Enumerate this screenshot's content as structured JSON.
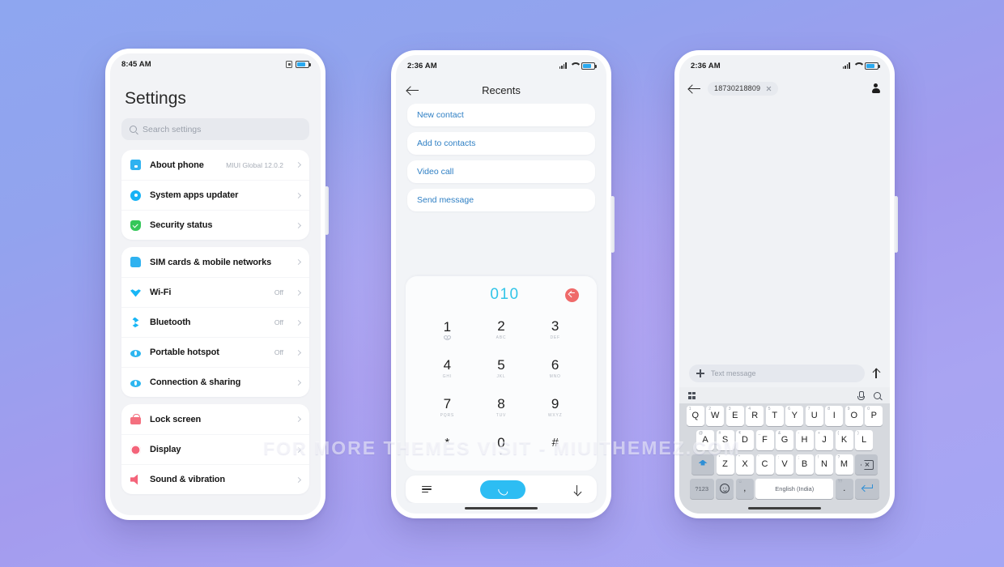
{
  "background": {
    "accent_blue": "#2dbdf3",
    "accent_cyan": "#33c5e8",
    "accent_red": "#ef6a6a",
    "link_blue": "#2e7fc4"
  },
  "watermark": {
    "text": "FOR MORE THEMES VISIT - MIUITHEMEZ.COM"
  },
  "phone1": {
    "status": {
      "time": "8:45 AM"
    },
    "title": "Settings",
    "search": {
      "placeholder": "Search settings"
    },
    "groups": [
      {
        "rows": [
          {
            "icon": "phone-info-icon",
            "label": "About phone",
            "value": "MIUI Global 12.0.2"
          },
          {
            "icon": "system-updater-icon",
            "label": "System apps updater",
            "value": ""
          },
          {
            "icon": "security-shield-icon",
            "label": "Security status",
            "value": ""
          }
        ]
      },
      {
        "rows": [
          {
            "icon": "sim-card-icon",
            "label": "SIM cards & mobile networks",
            "value": ""
          },
          {
            "icon": "wifi-icon",
            "label": "Wi-Fi",
            "value": "Off"
          },
          {
            "icon": "bluetooth-icon",
            "label": "Bluetooth",
            "value": "Off"
          },
          {
            "icon": "hotspot-icon",
            "label": "Portable hotspot",
            "value": "Off"
          },
          {
            "icon": "connection-sharing-icon",
            "label": "Connection & sharing",
            "value": ""
          }
        ]
      },
      {
        "rows": [
          {
            "icon": "lock-icon",
            "label": "Lock screen",
            "value": ""
          },
          {
            "icon": "display-icon",
            "label": "Display",
            "value": ""
          },
          {
            "icon": "sound-icon",
            "label": "Sound & vibration",
            "value": ""
          }
        ]
      }
    ]
  },
  "phone2": {
    "status": {
      "time": "2:36 AM"
    },
    "header": {
      "title": "Recents",
      "back": "back-arrow-icon"
    },
    "actions": [
      "New contact",
      "Add to contacts",
      "Video call",
      "Send message"
    ],
    "dialer": {
      "number": "010",
      "delete_label": "delete-button",
      "keys": [
        {
          "digit": "1",
          "letters": ""
        },
        {
          "digit": "2",
          "letters": "ABC"
        },
        {
          "digit": "3",
          "letters": "DEF"
        },
        {
          "digit": "4",
          "letters": "GHI"
        },
        {
          "digit": "5",
          "letters": "JKL"
        },
        {
          "digit": "6",
          "letters": "MNO"
        },
        {
          "digit": "7",
          "letters": "PQRS"
        },
        {
          "digit": "8",
          "letters": "TUV"
        },
        {
          "digit": "9",
          "letters": "WXYZ"
        },
        {
          "digit": "*",
          "letters": ""
        },
        {
          "digit": "0",
          "letters": "+"
        },
        {
          "digit": "#",
          "letters": ""
        }
      ],
      "bottom_bar": {
        "menu": "menu-icon",
        "call": "call-button",
        "hide": "hide-keypad-icon"
      }
    }
  },
  "phone3": {
    "status": {
      "time": "2:36 AM"
    },
    "header": {
      "number": "18730218809",
      "close": "clear-recipient-icon",
      "contact": "contact-icon"
    },
    "compose": {
      "placeholder": "Text message",
      "attach": "add-attachment-icon",
      "send": "send-icon"
    },
    "keyboard": {
      "toolbar": {
        "grid": "keyboard-switch-icon",
        "mic": "microphone-icon",
        "search": "search-icon"
      },
      "row1": [
        {
          "key": "Q",
          "hint": "1"
        },
        {
          "key": "W",
          "hint": "2"
        },
        {
          "key": "E",
          "hint": "3"
        },
        {
          "key": "R",
          "hint": "4"
        },
        {
          "key": "T",
          "hint": "5"
        },
        {
          "key": "Y",
          "hint": "6"
        },
        {
          "key": "U",
          "hint": "7"
        },
        {
          "key": "I",
          "hint": "8"
        },
        {
          "key": "O",
          "hint": "9"
        },
        {
          "key": "P",
          "hint": "0"
        }
      ],
      "row2": [
        {
          "key": "A",
          "hint": "@"
        },
        {
          "key": "S",
          "hint": "#"
        },
        {
          "key": "D",
          "hint": "₹"
        },
        {
          "key": "F",
          "hint": "_"
        },
        {
          "key": "G",
          "hint": "&"
        },
        {
          "key": "H",
          "hint": "-"
        },
        {
          "key": "J",
          "hint": "+"
        },
        {
          "key": "K",
          "hint": "("
        },
        {
          "key": "L",
          "hint": ")"
        }
      ],
      "row3": [
        {
          "key": "Z",
          "hint": "*"
        },
        {
          "key": "X",
          "hint": "\""
        },
        {
          "key": "C",
          "hint": "'"
        },
        {
          "key": "V",
          "hint": ":"
        },
        {
          "key": "B",
          "hint": ";"
        },
        {
          "key": "N",
          "hint": "!"
        },
        {
          "key": "M",
          "hint": "?"
        }
      ],
      "shift": "shift-key",
      "backspace": "backspace-key",
      "row4": {
        "symbols": "?123",
        "emoji": "emoji-key",
        "comma": ",",
        "comma_hint": "☺",
        "space": "English (India)",
        "period": ".",
        "period_hint": "??",
        "enter": "enter-key"
      }
    }
  }
}
